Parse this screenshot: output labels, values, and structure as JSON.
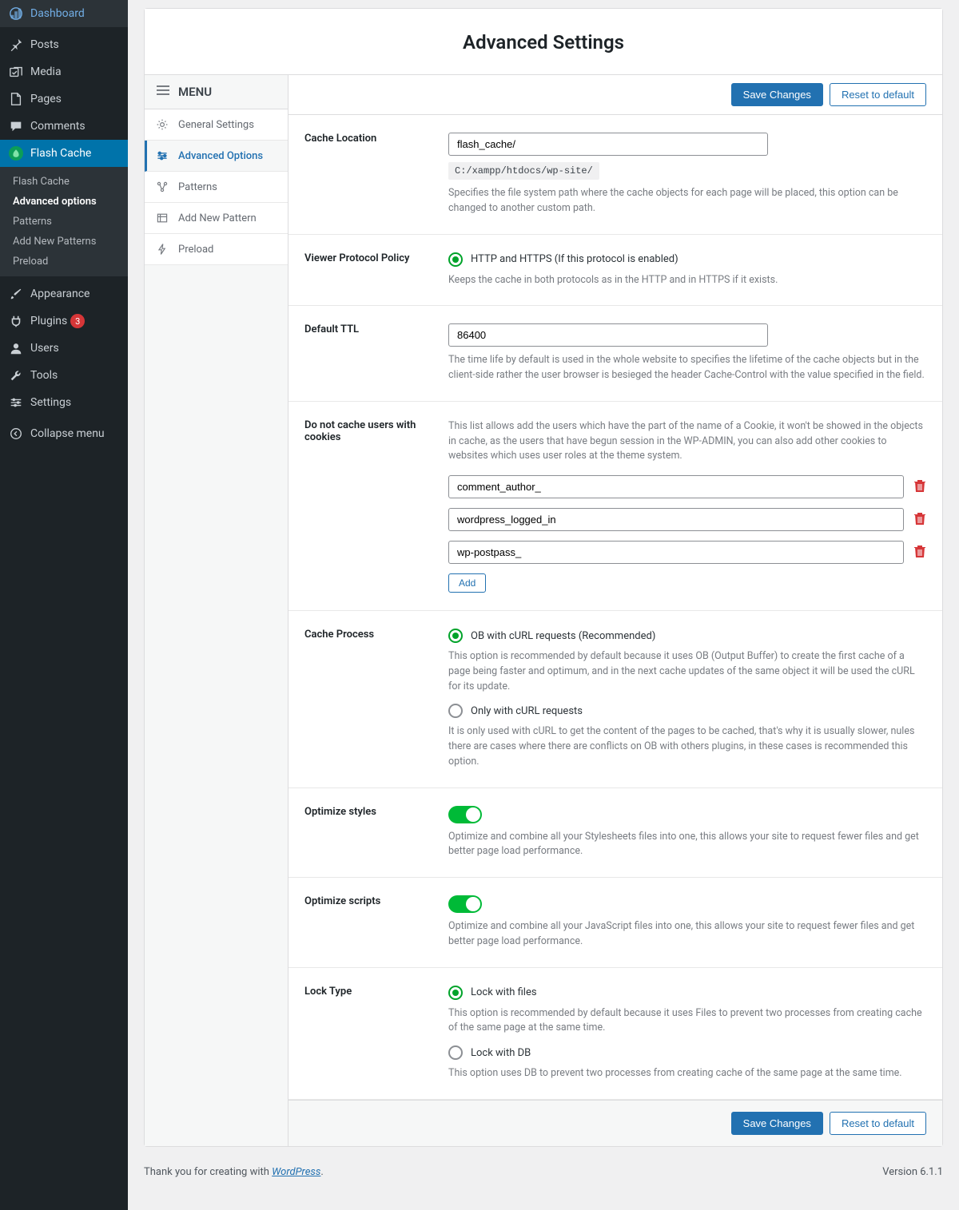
{
  "admin_menu": {
    "dashboard": "Dashboard",
    "posts": "Posts",
    "media": "Media",
    "pages": "Pages",
    "comments": "Comments",
    "flash_cache": "Flash Cache",
    "appearance": "Appearance",
    "plugins": "Plugins",
    "plugins_badge": "3",
    "users": "Users",
    "tools": "Tools",
    "settings": "Settings",
    "collapse": "Collapse menu"
  },
  "flash_submenu": {
    "flash_cache": "Flash Cache",
    "advanced_options": "Advanced options",
    "patterns": "Patterns",
    "add_new_patterns": "Add New Patterns",
    "preload": "Preload"
  },
  "page_title": "Advanced Settings",
  "inner_menu": {
    "heading": "MENU",
    "general": "General Settings",
    "advanced": "Advanced Options",
    "patterns": "Patterns",
    "add_pattern": "Add New Pattern",
    "preload": "Preload"
  },
  "buttons": {
    "save": "Save Changes",
    "reset": "Reset to default",
    "add": "Add"
  },
  "fields": {
    "cache_location": {
      "label": "Cache Location",
      "value": "flash_cache/",
      "path": "C:/xampp/htdocs/wp-site/",
      "help": "Specifies the file system path where the cache objects for each page will be placed, this option can be changed to another custom path."
    },
    "viewer_protocol": {
      "label": "Viewer Protocol Policy",
      "option": "HTTP and HTTPS (If this protocol is enabled)",
      "help": "Keeps the cache in both protocols as in the HTTP and in HTTPS if it exists."
    },
    "default_ttl": {
      "label": "Default TTL",
      "value": "86400",
      "help": "The time life by default is used in the whole website to specifies the lifetime of the cache objects but in the client-side rather the user browser is besieged the header Cache-Control with the value specified in the field."
    },
    "cookies": {
      "label": "Do not cache users with cookies",
      "help": "This list allows add the users which have the part of the name of a Cookie, it won't be showed in the objects in cache, as the users that have begun session in the WP-ADMIN, you can also add other cookies to websites which uses user roles at the theme system.",
      "items": [
        "comment_author_",
        "wordpress_logged_in",
        "wp-postpass_"
      ]
    },
    "cache_process": {
      "label": "Cache Process",
      "opt1": "OB with cURL requests (Recommended)",
      "help1": "This option is recommended by default because it uses OB (Output Buffer) to create the first cache of a page being faster and optimum, and in the next cache updates of the same object it will be used the cURL for its update.",
      "opt2": "Only with cURL requests",
      "help2": "It is only used with cURL to get the content of the pages to be cached, that's why it is usually slower, nules there are cases where there are conflicts on OB with others plugins, in these cases is recommended this option."
    },
    "optimize_styles": {
      "label": "Optimize styles",
      "help": "Optimize and combine all your Stylesheets files into one, this allows your site to request fewer files and get better page load performance."
    },
    "optimize_scripts": {
      "label": "Optimize scripts",
      "help": "Optimize and combine all your JavaScript files into one, this allows your site to request fewer files and get better page load performance."
    },
    "lock_type": {
      "label": "Lock Type",
      "opt1": "Lock with files",
      "help1": "This option is recommended by default because it uses Files to prevent two processes from creating cache of the same page at the same time.",
      "opt2": "Lock with DB",
      "help2": "This option uses DB to prevent two processes from creating cache of the same page at the same time."
    }
  },
  "footer": {
    "thanks_prefix": "Thank you for creating with ",
    "wordpress": "WordPress",
    "version": "Version 6.1.1"
  }
}
